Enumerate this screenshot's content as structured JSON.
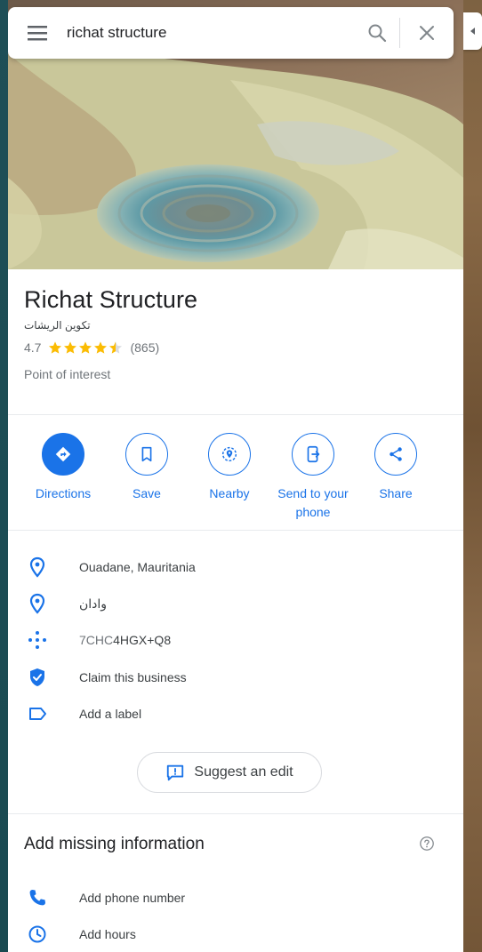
{
  "search": {
    "query": "richat structure"
  },
  "place": {
    "name": "Richat Structure",
    "native_name": "تكوين الريشات",
    "rating": "4.7",
    "stars": 4.5,
    "review_count": "(865)",
    "category": "Point of interest"
  },
  "actions": [
    {
      "label": "Directions",
      "icon": "directions-icon"
    },
    {
      "label": "Save",
      "icon": "bookmark-icon"
    },
    {
      "label": "Nearby",
      "icon": "nearby-icon"
    },
    {
      "label": "Send to your phone",
      "icon": "send-to-phone-icon"
    },
    {
      "label": "Share",
      "icon": "share-icon"
    }
  ],
  "info": {
    "address": "Ouadane, Mauritania",
    "address_native": "وادان",
    "plus_code_prefix": "7CHC",
    "plus_code_suffix": "4HGX+Q8",
    "claim": "Claim this business",
    "label": "Add a label"
  },
  "suggest_edit": "Suggest an edit",
  "missing": {
    "title": "Add missing information",
    "phone": "Add phone number",
    "hours": "Add hours"
  },
  "colors": {
    "accent": "#1a73e8",
    "star": "#fbbc04",
    "text_secondary": "#70757a"
  }
}
